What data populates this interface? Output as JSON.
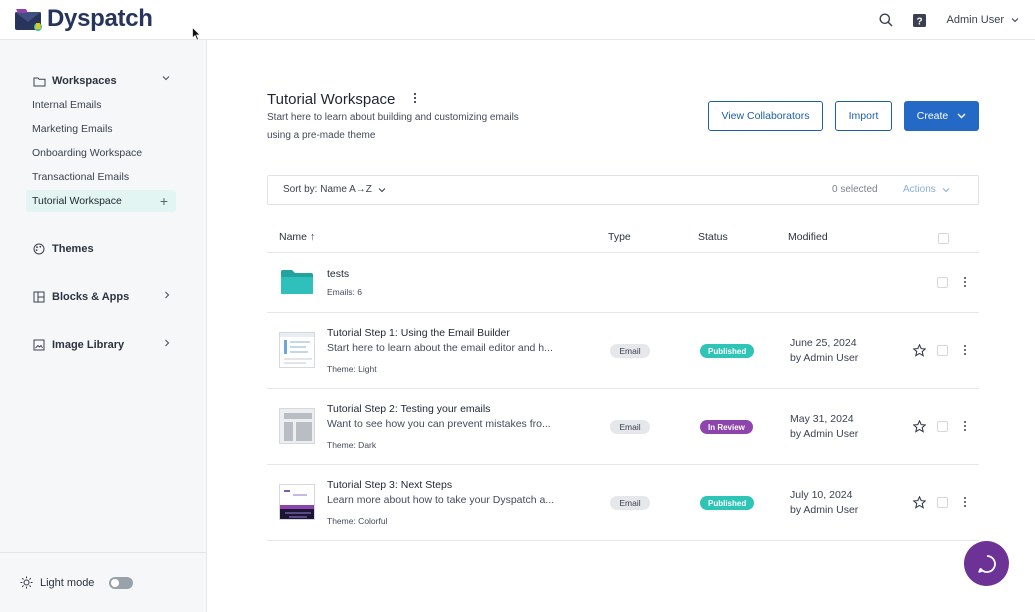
{
  "app": {
    "logo_text": "Dyspatch"
  },
  "header": {
    "user_name": "Admin User"
  },
  "sidebar": {
    "workspaces_label": "Workspaces",
    "workspaces": [
      {
        "label": "Internal Emails"
      },
      {
        "label": "Marketing Emails"
      },
      {
        "label": "Onboarding Workspace"
      },
      {
        "label": "Transactional Emails"
      },
      {
        "label": "Tutorial Workspace"
      }
    ],
    "themes_label": "Themes",
    "blocks_label": "Blocks & Apps",
    "image_library_label": "Image Library",
    "light_mode_label": "Light mode"
  },
  "workspace": {
    "title": "Tutorial Workspace",
    "description": "Start here to learn about building and customizing emails using a pre-made theme",
    "view_collaborators": "View Collaborators",
    "import": "Import",
    "create": "Create"
  },
  "toolbar": {
    "sort_label": "Sort by: Name A→Z",
    "selected_count": "0 selected",
    "actions": "Actions"
  },
  "table": {
    "headers": {
      "name": "Name ↑",
      "type": "Type",
      "status": "Status",
      "modified": "Modified"
    },
    "folder": {
      "name": "tests",
      "meta": "Emails: 6"
    },
    "rows": [
      {
        "title": "Tutorial Step 1: Using the Email Builder",
        "description": "Start here to learn about the email editor and h...",
        "theme": "Theme: Light",
        "type": "Email",
        "status": "Published",
        "date": "June 25, 2024",
        "by": "by Admin User"
      },
      {
        "title": "Tutorial Step 2: Testing your emails",
        "description": "Want to see how you can prevent mistakes fro...",
        "theme": "Theme: Dark",
        "type": "Email",
        "status": "In Review",
        "date": "May 31, 2024",
        "by": "by Admin User"
      },
      {
        "title": "Tutorial Step 3: Next Steps",
        "description": "Learn more about how to take your Dyspatch a...",
        "theme": "Theme: Colorful",
        "type": "Email",
        "status": "Published",
        "date": "July 10, 2024",
        "by": "by Admin User"
      }
    ]
  },
  "colors": {
    "published": "#2ec4b6",
    "in_review": "#8e44ad",
    "primary": "#2469c5",
    "brand": "#27345b",
    "chat": "#6c3296",
    "folder": "#2bb3b0"
  }
}
